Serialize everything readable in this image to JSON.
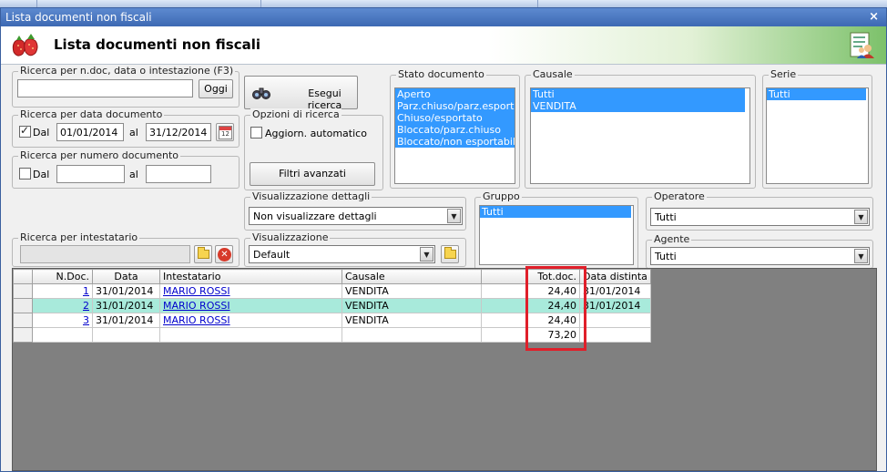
{
  "window": {
    "title": "Lista documenti non fiscali",
    "close_label": "×"
  },
  "header": {
    "title": "Lista documenti non fiscali"
  },
  "search_ndoc": {
    "legend": "Ricerca per n.doc, data o intestazione (F3)",
    "value": "",
    "oggi_label": "Oggi"
  },
  "search_button": {
    "label": "Esegui ricerca"
  },
  "search_date": {
    "legend": "Ricerca per data documento",
    "dal_label": "Dal",
    "dal_checked": true,
    "from": "01/01/2014",
    "al_label": "al",
    "to": "31/12/2014",
    "calendar_icon": "calendar-icon"
  },
  "search_number": {
    "legend": "Ricerca per numero documento",
    "dal_label": "Dal",
    "dal_checked": false,
    "from": "",
    "al_label": "al",
    "to": ""
  },
  "search_options": {
    "legend": "Opzioni di ricerca",
    "auto_update_label": "Aggiorn. automatico",
    "auto_update_checked": false,
    "advanced_filters_label": "Filtri avanzati"
  },
  "stato_documento": {
    "legend": "Stato documento",
    "options": [
      "Aperto",
      "Parz.chiuso/parz.esportato",
      "Chiuso/esportato",
      "Bloccato/parz.chiuso",
      "Bloccato/non esportabile"
    ]
  },
  "causale": {
    "legend": "Causale",
    "options": [
      "Tutti",
      "VENDITA"
    ]
  },
  "serie": {
    "legend": "Serie",
    "options": [
      "Tutti"
    ]
  },
  "dettagli": {
    "legend": "Visualizzazione dettagli",
    "selected": "Non visualizzare dettagli"
  },
  "gruppo": {
    "legend": "Gruppo",
    "options": [
      "Tutti"
    ]
  },
  "operatore": {
    "legend": "Operatore",
    "selected": "Tutti"
  },
  "intestatario": {
    "legend": "Ricerca per intestatario",
    "value": ""
  },
  "visualizzazione": {
    "legend": "Visualizzazione",
    "selected": "Default"
  },
  "agente": {
    "legend": "Agente",
    "selected": "Tutti"
  },
  "grid": {
    "columns": [
      "N.Doc.",
      "Data",
      "Intestatario",
      "Causale",
      "Tot.doc.",
      "Data distinta"
    ],
    "rows": [
      {
        "ndoc": "1",
        "data": "31/01/2014",
        "intestatario": "MARIO ROSSI",
        "causale": "VENDITA",
        "tot": "24,40",
        "distinta": "31/01/2014"
      },
      {
        "ndoc": "2",
        "data": "31/01/2014",
        "intestatario": "MARIO ROSSI",
        "causale": "VENDITA",
        "tot": "24,40",
        "distinta": "31/01/2014"
      },
      {
        "ndoc": "3",
        "data": "31/01/2014",
        "intestatario": "MARIO ROSSI",
        "causale": "VENDITA",
        "tot": "24,40",
        "distinta": ""
      }
    ],
    "total": "73,20",
    "highlighted_row": 1
  },
  "colors": {
    "highlight_row": "#a8eadb",
    "selection": "#3399ff",
    "annotation_box": "#e01f2a",
    "title_bar": "#3d69b3"
  }
}
